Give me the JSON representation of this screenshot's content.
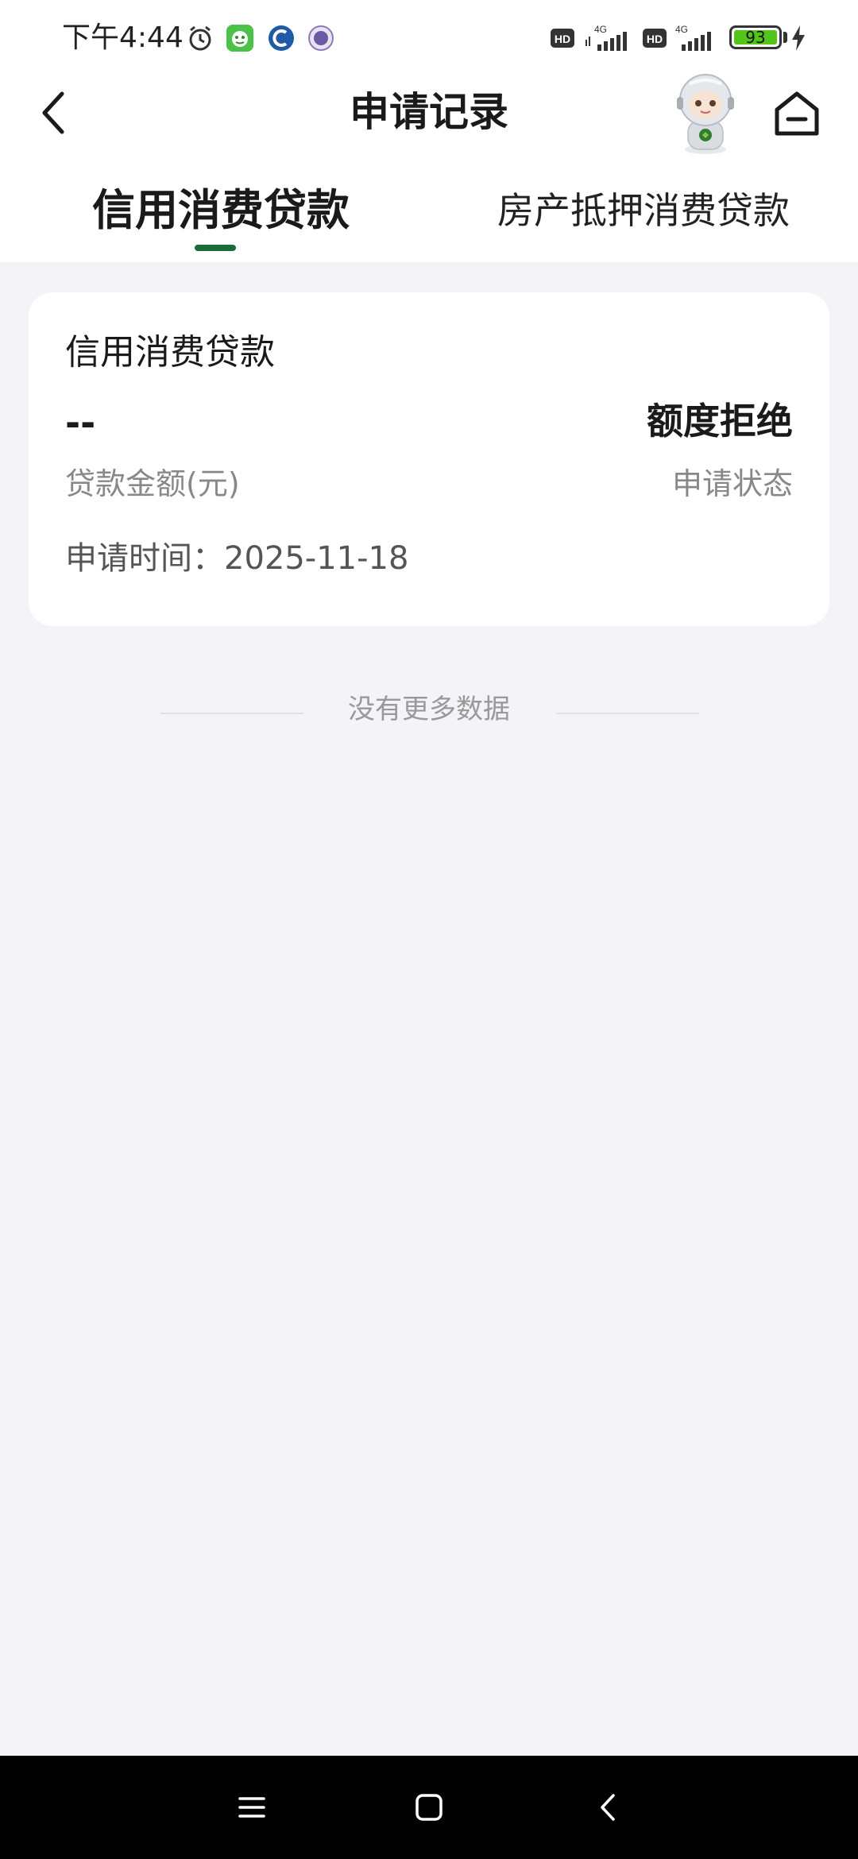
{
  "status_bar": {
    "time": "下午4:44",
    "battery_level": "93",
    "network_1": "4G",
    "network_2": "4G"
  },
  "nav": {
    "title": "申请记录"
  },
  "tabs": [
    {
      "label": "信用消费贷款",
      "active": true
    },
    {
      "label": "房产抵押消费贷款",
      "active": false
    }
  ],
  "record": {
    "title": "信用消费贷款",
    "amount_value": "--",
    "amount_label": "贷款金额(元)",
    "status_value": "额度拒绝",
    "status_label": "申请状态",
    "apply_time": "申请时间：2025-11-18"
  },
  "list_footer": {
    "text": "没有更多数据"
  },
  "colors": {
    "accent": "#1b6b3a",
    "background": "#f3f3f8",
    "card": "#ffffff",
    "battery": "#52c41a"
  }
}
